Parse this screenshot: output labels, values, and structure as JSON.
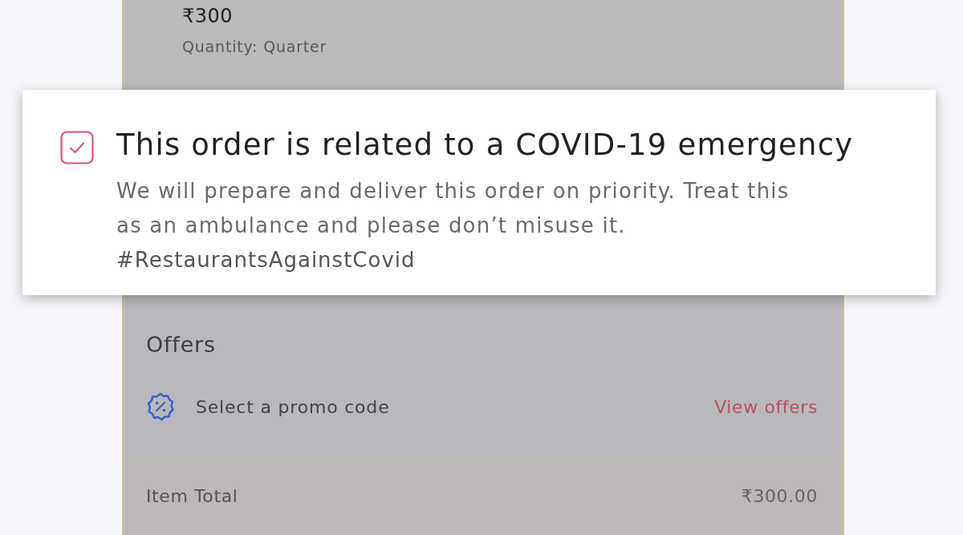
{
  "item": {
    "price": "₹300",
    "quantity": "Quantity: Quarter"
  },
  "covid_emergency": {
    "checked": true,
    "title": "This order is related to a COVID-19 emergency",
    "description": "We will prepare and deliver this order on priority. Treat this as an ambulance and please don’t misuse it.",
    "hashtag": "#RestaurantsAgainstCovid"
  },
  "offers": {
    "title": "Offers",
    "promo_label": "Select a promo code",
    "link": "View offers"
  },
  "bill": {
    "rows": [
      {
        "label": "Item Total",
        "value": "₹300.00"
      }
    ]
  }
}
